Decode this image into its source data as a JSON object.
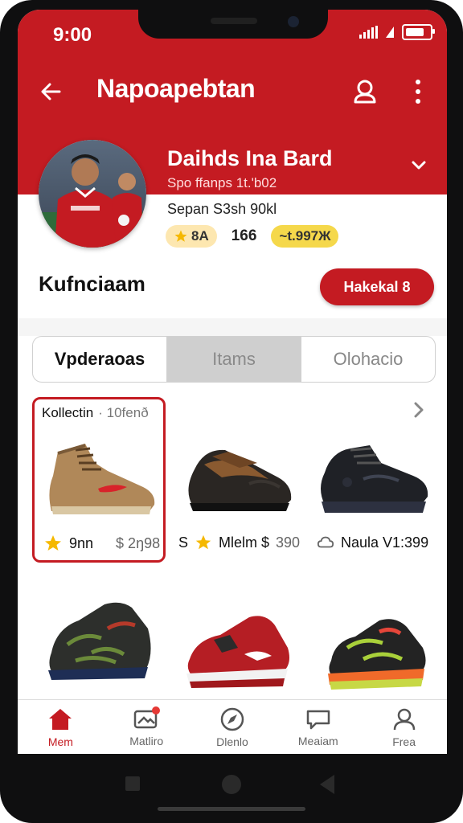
{
  "status": {
    "time": "9:00"
  },
  "appbar": {
    "title": "Napoapebtan"
  },
  "profile": {
    "name": "Daihds Ina Bard",
    "handle": "Spo ffanps 1t.'b02",
    "subtitle": "Sepan S3sh 90kl",
    "rating_badge": "8A",
    "count": "166",
    "points_badge": "~t.997Ж"
  },
  "section": {
    "title": "Kufnciaam",
    "follow_label": "Hakekal 8"
  },
  "tabs": [
    {
      "label": "Vpderaoas"
    },
    {
      "label": "Itams"
    },
    {
      "label": "Olohacio"
    }
  ],
  "collection": {
    "label": "Kollectin",
    "count": "· 10fenð"
  },
  "products": [
    {
      "name": "9nn",
      "price": "$ 2ŋ98"
    },
    {
      "prefix": "S",
      "name": "Mlelm $",
      "price": "390"
    },
    {
      "name": "Naula V1:399"
    }
  ],
  "nav": [
    {
      "label": "Mem",
      "icon": "home-icon"
    },
    {
      "label": "Matliro",
      "icon": "image-icon"
    },
    {
      "label": "Dlenlo",
      "icon": "compass-icon"
    },
    {
      "label": "Meaiam",
      "icon": "chat-icon"
    },
    {
      "label": "Frea",
      "icon": "person-icon"
    }
  ],
  "colors": {
    "brand": "#c41b22",
    "star": "#f5b800"
  }
}
